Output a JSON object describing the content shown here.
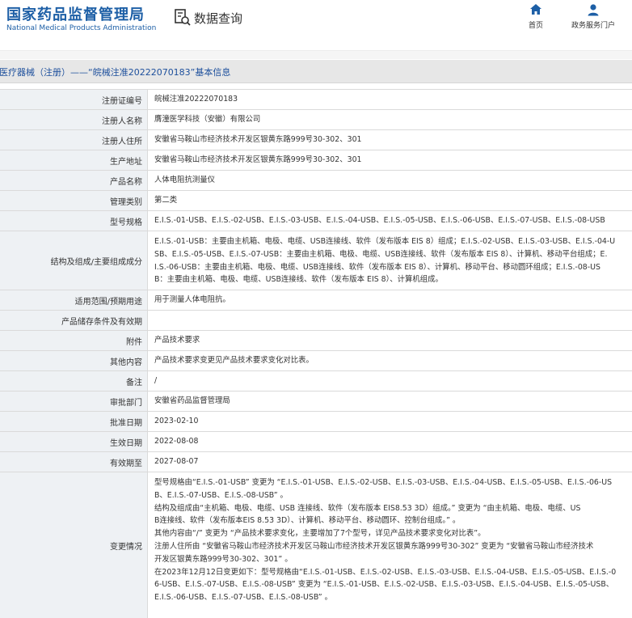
{
  "header": {
    "logo_cn": "国家药品监督管理局",
    "logo_en": "National Medical Products Administration",
    "query_label": "数据查询",
    "nav": {
      "home": "首页",
      "service": "政务服务门户"
    }
  },
  "breadcrumb": "医疗器械（注册）——“皖械注准20222070183”基本信息",
  "rows": [
    {
      "label": "注册证编号",
      "value": "皖械注准20222070183"
    },
    {
      "label": "注册人名称",
      "value": "膺潼医学科技（安徽）有限公司"
    },
    {
      "label": "注册人住所",
      "value": "安徽省马鞍山市经济技术开发区银黄东路999号30-302、301"
    },
    {
      "label": "生产地址",
      "value": "安徽省马鞍山市经济技术开发区银黄东路999号30-302、301"
    },
    {
      "label": "产品名称",
      "value": "人体电阻抗测量仪"
    },
    {
      "label": "管理类别",
      "value": "第二类"
    },
    {
      "label": "型号规格",
      "value": "E.I.S.-01-USB、E.I.S.-02-USB、E.I.S.-03-USB、E.I.S.-04-USB、E.I.S.-05-USB、E.I.S.-06-USB、E.I.S.-07-USB、E.I.S.-08-USB"
    },
    {
      "label": "结构及组成/主要组成成分",
      "lines": [
        "E.I.S.-01-USB：主要由主机箱、电极、电缆、USB连接线、软件（发布版本 EIS 8）组成；E.I.S.-02-USB、E.I.S.-03-USB、E.I.S.-04-U",
        "SB、E.I.S.-05-USB、E.I.S.-07-USB：主要由主机箱、电极、电缆、USB连接线、软件（发布版本 EIS 8）、计算机、移动平台组成；E.",
        "I.S.-06-USB：主要由主机箱、电极、电缆、USB连接线、软件（发布版本 EIS 8）、计算机、移动平台、移动圆环组成；E.I.S.-08-US",
        "B：主要由主机箱、电极、电缆、USB连接线、软件（发布版本 EIS 8）、计算机组成。"
      ]
    },
    {
      "label": "适用范围/预期用途",
      "value": "用于测量人体电阻抗。"
    },
    {
      "label": "产品储存条件及有效期",
      "value": ""
    },
    {
      "label": "附件",
      "value": "产品技术要求"
    },
    {
      "label": "其他内容",
      "value": "产品技术要求变更见产品技术要求变化对比表。"
    },
    {
      "label": "备注",
      "value": "/"
    },
    {
      "label": "审批部门",
      "value": "安徽省药品监督管理局"
    },
    {
      "label": "批准日期",
      "value": "2023-02-10"
    },
    {
      "label": "生效日期",
      "value": "2022-08-08"
    },
    {
      "label": "有效期至",
      "value": "2027-08-07"
    },
    {
      "label": "变更情况",
      "lines": [
        "型号规格由“E.I.S.-01-USB” 变更为 “E.I.S.-01-USB、E.I.S.-02-USB、E.I.S.-03-USB、E.I.S.-04-USB、E.I.S.-05-USB、E.I.S.-06-US",
        "B、E.I.S.-07-USB、E.I.S.-08-USB” 。",
        "结构及组成由“主机箱、电极、电缆、USB 连接线、软件（发布版本 EIS8.53 3D）组成。” 变更为 “由主机箱、电极、电缆、US",
        "B连接线、软件（发布版本EIS 8.53 3D）、计算机、移动平台、移动圆环、控制台组成。” 。",
        "其他内容由“/” 变更为 “产品技术要求变化，主要增加了7个型号，详见产品技术要求变化对比表”。",
        "注册人住所由 “安徽省马鞍山市经济技术开发区马鞍山市经济技术开发区银黄东路999号30-302” 变更为 “安徽省马鞍山市经济技术",
        "开发区银黄东路999号30-302、301” 。",
        "在2023年12月12日变更如下：型号规格由“E.I.S.-01-USB、E.I.S.-02-USB、E.I.S.-03-USB、E.I.S.-04-USB、E.I.S.-05-USB、E.I.S.-0",
        "6-USB、E.I.S.-07-USB、E.I.S.-08-USB” 变更为 “E.I.S.-01-USB、E.I.S.-02-USB、E.I.S.-03-USB、E.I.S.-04-USB、E.I.S.-05-USB、",
        "E.I.S.-06-USB、E.I.S.-07-USB、E.I.S.-08-USB” 。"
      ]
    }
  ],
  "colors": {
    "brand": "#1d5fa6",
    "label_bg": "#eef1f4",
    "border": "#dadada"
  },
  "icons": {
    "query": "search-document-icon",
    "home": "home-icon",
    "service": "user-icon"
  }
}
